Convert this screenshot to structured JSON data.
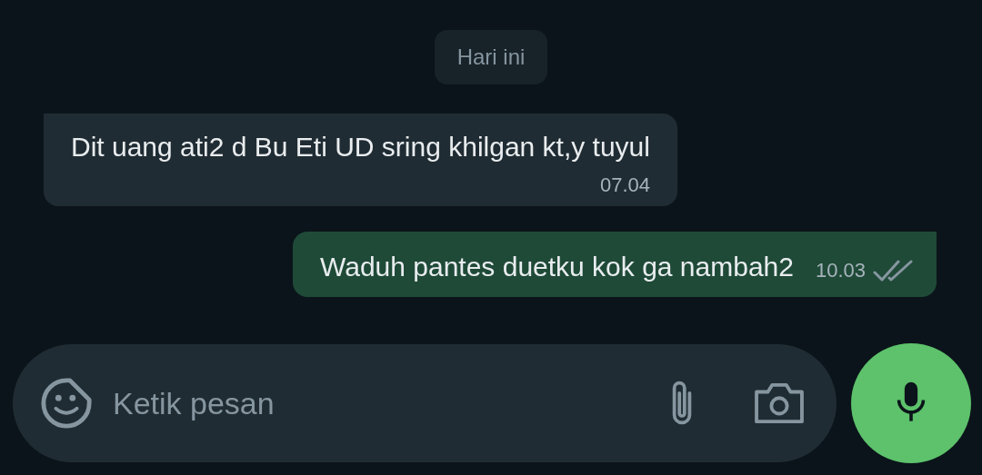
{
  "date_chip": "Hari ini",
  "messages": [
    {
      "kind": "incoming",
      "text": "Dit uang ati2 d Bu Eti UD sring khilgan kt,y tuyul",
      "time": "07.04"
    },
    {
      "kind": "outgoing",
      "text": "Waduh pantes duetku kok ga nambah2",
      "time": "10.03",
      "read": false
    }
  ],
  "composer": {
    "placeholder": "Ketik pesan"
  }
}
